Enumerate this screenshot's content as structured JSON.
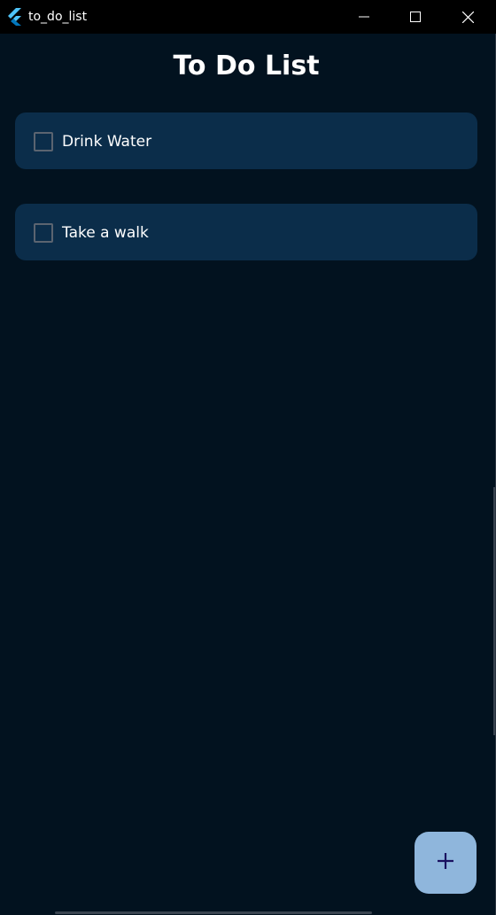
{
  "window": {
    "title": "to_do_list",
    "icon": "flutter-logo-icon",
    "controls": {
      "minimize_icon": "minimize-icon",
      "maximize_icon": "maximize-icon",
      "close_icon": "close-icon"
    }
  },
  "page": {
    "title": "To Do List"
  },
  "todos": [
    {
      "label": "Drink Water",
      "checked": false
    },
    {
      "label": "Take a walk",
      "checked": false
    }
  ],
  "fab": {
    "icon": "plus-icon"
  },
  "colors": {
    "background": "#02121f",
    "card": "#0b2d4a",
    "fab": "#8fb6dc",
    "fab_icon": "#1a1060",
    "titlebar": "#000000",
    "text": "#ffffff"
  }
}
